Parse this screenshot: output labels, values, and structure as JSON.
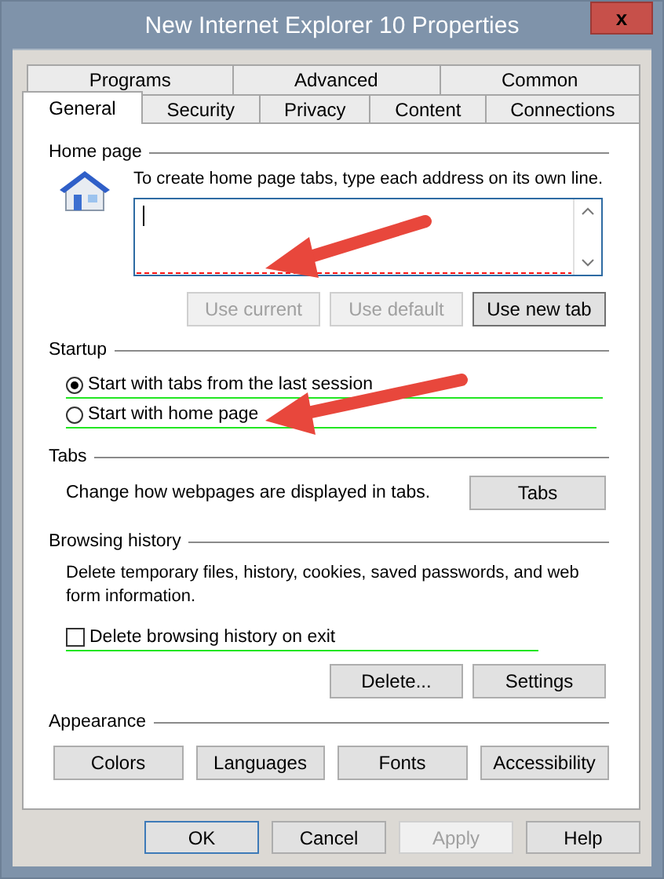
{
  "window": {
    "title": "New Internet Explorer 10 Properties",
    "close": "x"
  },
  "tab_rows": [
    [
      {
        "label": "Programs",
        "selected": false
      },
      {
        "label": "Advanced",
        "selected": false
      },
      {
        "label": "Common",
        "selected": false
      }
    ],
    [
      {
        "label": "General",
        "selected": true
      },
      {
        "label": "Security",
        "selected": false
      },
      {
        "label": "Privacy",
        "selected": false
      },
      {
        "label": "Content",
        "selected": false
      },
      {
        "label": "Connections",
        "selected": false
      }
    ]
  ],
  "home_page": {
    "heading": "Home page",
    "hint": "To create home page tabs, type each address on its own line.",
    "buttons": [
      {
        "label": "Use current",
        "disabled": true
      },
      {
        "label": "Use default",
        "disabled": true
      },
      {
        "label": "Use new tab",
        "disabled": false
      }
    ]
  },
  "startup": {
    "heading": "Startup",
    "options": [
      {
        "label": "Start with tabs from the last session",
        "selected": true
      },
      {
        "label": "Start with home page",
        "selected": false
      }
    ]
  },
  "tabs_section": {
    "heading": "Tabs",
    "text": "Change how webpages are displayed in tabs.",
    "button": "Tabs"
  },
  "browsing_history": {
    "heading": "Browsing history",
    "text": "Delete temporary files, history, cookies, saved passwords, and web form information.",
    "checkbox": {
      "label": "Delete browsing history on exit",
      "checked": false
    },
    "buttons": [
      "Delete...",
      "Settings"
    ]
  },
  "appearance": {
    "heading": "Appearance",
    "buttons": [
      "Colors",
      "Languages",
      "Fonts",
      "Accessibility"
    ]
  },
  "footer_buttons": [
    {
      "label": "OK",
      "disabled": false,
      "default": true
    },
    {
      "label": "Cancel",
      "disabled": false,
      "default": false
    },
    {
      "label": "Apply",
      "disabled": true,
      "default": false
    },
    {
      "label": "Help",
      "disabled": false,
      "default": false
    }
  ]
}
